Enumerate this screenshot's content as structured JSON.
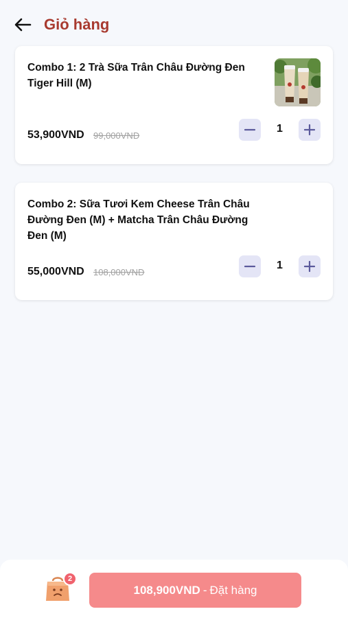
{
  "header": {
    "title": "Giỏ hàng"
  },
  "cart_items": [
    {
      "name": "Combo 1: 2 Trà Sữa Trân Châu Đường Đen Tiger Hill (M)",
      "price": "53,900VND",
      "old_price": "99,000VND",
      "quantity": "1",
      "has_image": true
    },
    {
      "name": "Combo 2: Sữa Tươi Kem Cheese Trân Châu Đường Đen (M) + Matcha Trân Châu Đường Đen (M)",
      "price": "55,000VND",
      "old_price": "108,000VND",
      "quantity": "1",
      "has_image": false
    }
  ],
  "footer": {
    "cart_count": "2",
    "total": "108,900VND",
    "separator": "-",
    "action_label": "Đặt hàng"
  },
  "colors": {
    "title": "#a83a2f",
    "order_button": "#f58a8b",
    "stepper_bg": "#e4e5f6",
    "stepper_icon": "#5b5a9c",
    "badge": "#f0626d",
    "cart_bag": "#f0a06c"
  },
  "icons": {
    "back": "arrow-left-icon",
    "minus": "minus-icon",
    "plus": "plus-icon",
    "cart": "shopping-bag-icon"
  }
}
